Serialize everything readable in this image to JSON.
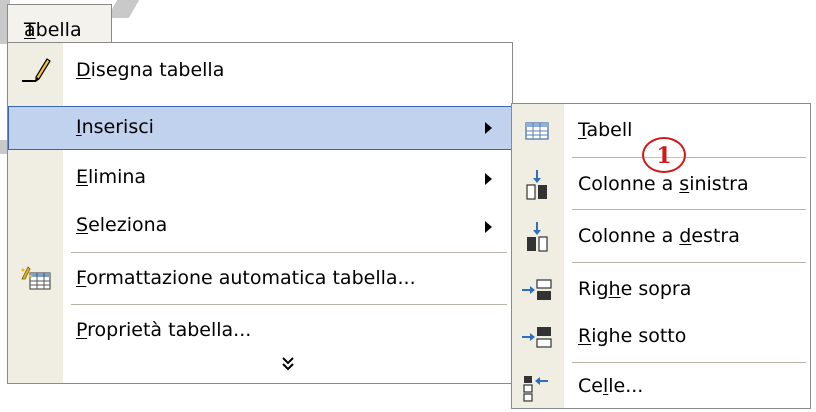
{
  "menubar": {
    "title": "Tabella",
    "title_prefix": "T",
    "title_rest": "abella"
  },
  "main_menu": {
    "items": [
      {
        "key": "D",
        "rest": "isegna tabella",
        "label": "Disegna tabella",
        "icon": "pencil-icon"
      },
      {
        "key": "I",
        "rest": "nserisci",
        "label": "Inserisci",
        "has_submenu": true,
        "selected": true
      },
      {
        "key": "E",
        "rest": "limina",
        "label": "Elimina",
        "has_submenu": true
      },
      {
        "key": "S",
        "rest": "eleziona",
        "label": "Seleziona",
        "has_submenu": true
      },
      {
        "key": "F",
        "rest": "ormattazione automatica tabella...",
        "label": "Formattazione automatica tabella...",
        "icon": "table-autoformat-icon"
      },
      {
        "key": "P",
        "rest": "roprietà tabella...",
        "label": "Proprietà tabella..."
      }
    ],
    "expand_glyph": "»"
  },
  "sub_menu": {
    "items": [
      {
        "pre": "",
        "key": "T",
        "post": "abell",
        "label": "Tabell",
        "icon": "insert-table-icon"
      },
      {
        "pre": "Colonne a ",
        "key": "s",
        "post": "inistra",
        "label": "Colonne a sinistra",
        "icon": "insert-columns-left-icon"
      },
      {
        "pre": "Colonne a ",
        "key": "d",
        "post": "estra",
        "label": "Colonne a destra",
        "icon": "insert-columns-right-icon"
      },
      {
        "pre": "Rig",
        "key": "h",
        "post": "e sopra",
        "label": "Righe sopra",
        "icon": "insert-rows-above-icon"
      },
      {
        "pre": "",
        "key": "R",
        "post": "ighe sotto",
        "label": "Righe sotto",
        "icon": "insert-rows-below-icon"
      },
      {
        "pre": "Ce",
        "key": "l",
        "post": "le...",
        "label": "Celle...",
        "icon": "insert-cells-icon"
      }
    ]
  },
  "callout": {
    "text": "1",
    "color": "#d01818"
  },
  "colors": {
    "selection": "#c0d2ee",
    "selection_border": "#3c64b4",
    "gutter": "#f0ede2",
    "border": "#8a8a8a"
  }
}
